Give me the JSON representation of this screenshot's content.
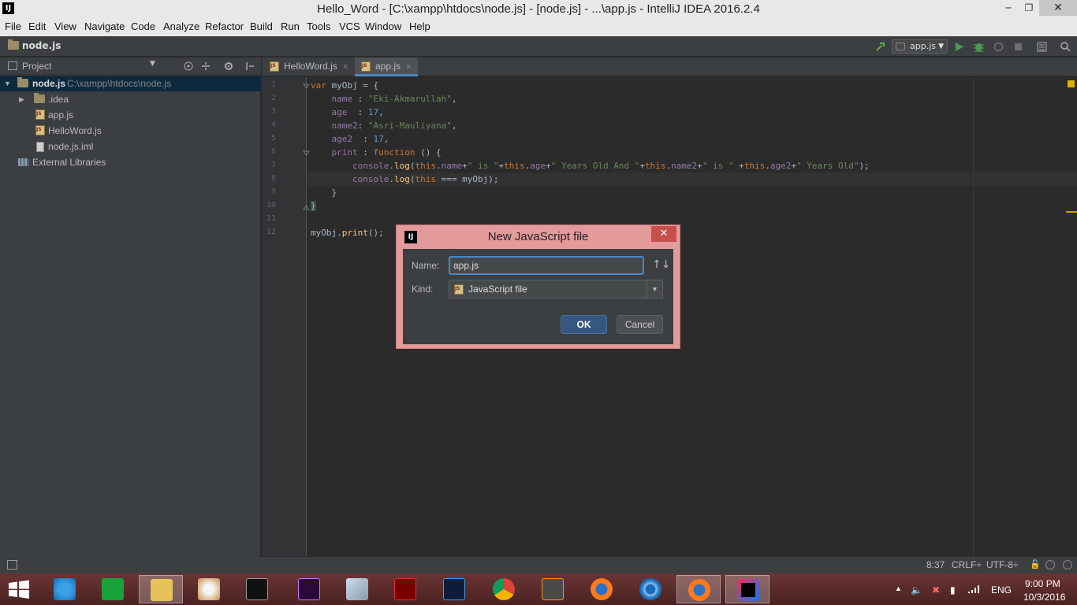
{
  "window": {
    "title": "Hello_Word - [C:\\xampp\\htdocs\\node.js] - [node.js] - ...\\app.js - IntelliJ IDEA 2016.2.4",
    "logo": "IJ",
    "minimize": "─",
    "maximize": "❐",
    "close": "✕"
  },
  "menu": [
    "File",
    "Edit",
    "View",
    "Navigate",
    "Code",
    "Analyze",
    "Refactor",
    "Build",
    "Run",
    "Tools",
    "VCS",
    "Window",
    "Help"
  ],
  "navbar": {
    "breadcrumb": "node.js",
    "run_config": "app.js"
  },
  "project_panel": {
    "title": "Project",
    "tree": [
      {
        "label": "node.js",
        "path": "C:\\xampp\\htdocs\\node.js"
      },
      {
        "label": ".idea"
      },
      {
        "label": "app.js"
      },
      {
        "label": "HelloWord.js"
      },
      {
        "label": "node.js.iml"
      },
      {
        "label": "External Libraries"
      }
    ]
  },
  "tabs": [
    {
      "label": "HelloWord.js",
      "close": "×"
    },
    {
      "label": "app.js",
      "close": "×"
    }
  ],
  "editor": {
    "line_numbers": [
      "1",
      "2",
      "3",
      "4",
      "5",
      "6",
      "7",
      "8",
      "9",
      "10",
      "11",
      "12"
    ],
    "lines": [
      "var myObj = {",
      "    name : \"Eki-Akmarullah\",",
      "    age  : 17,",
      "    name2: \"Asri-Mauliyana\",",
      "    age2  : 17,",
      "    print : function () {",
      "        console.log(this.name+\" is \"+this.age+\" Years Old And \"+this.name2+\" is \" +this.age2+\" Years Old\");",
      "        console.log(this === myObj);",
      "    }",
      "}",
      "",
      "myObj.print();"
    ]
  },
  "dialog": {
    "logo": "IJ",
    "title": "New JavaScript file",
    "close": "✕",
    "name_label": "Name:",
    "name_value": "app.js",
    "kind_label": "Kind:",
    "kind_value": "JavaScript file",
    "sort_icon": "↑↓",
    "ok": "OK",
    "cancel": "Cancel"
  },
  "status": {
    "position": "8:37",
    "line_sep": "CRLF÷",
    "encoding": "UTF-8÷"
  },
  "tray": {
    "lang": "ENG",
    "time": "9:00 PM",
    "date": "10/3/2016"
  },
  "colors": {
    "editor_bg": "#2b2b2b",
    "panel_bg": "#3c3f41",
    "selection": "#0d293e",
    "dialog_frame": "#e49a9a",
    "ok_button": "#365880",
    "taskbar": "#5a2c2c"
  }
}
